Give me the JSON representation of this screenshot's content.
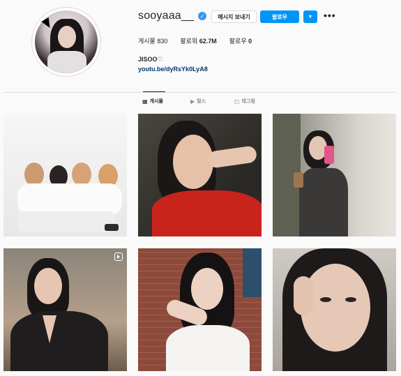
{
  "profile": {
    "username": "sooyaaa__",
    "verified_icon": "verified-badge-icon",
    "message_button": "메시지 보내기",
    "follow_button": "팔로우",
    "dropdown_icon": "chevron-down-icon",
    "more_icon": "more-options-icon",
    "more_glyph": "•••",
    "stats": {
      "posts_label": "게시물",
      "posts_value": "830",
      "followers_label": "팔로워",
      "followers_value": "62.7M",
      "following_label": "팔로우",
      "following_value": "0"
    },
    "bio_name": "JISOO♡",
    "bio_link": "youtu.be/dyRsYk0LyA8"
  },
  "tabs": [
    {
      "label": "게시물",
      "icon": "grid-icon",
      "glyph": "▦",
      "active": true
    },
    {
      "label": "릴스",
      "icon": "reels-icon",
      "glyph": "▶",
      "active": false
    },
    {
      "label": "태그됨",
      "icon": "tagged-icon",
      "glyph": "◰",
      "active": false
    }
  ],
  "posts": [
    {
      "id": "post-1",
      "type": "image",
      "colors": [
        "#f2f2f2",
        "#e6e2e0"
      ]
    },
    {
      "id": "post-2",
      "type": "image",
      "colors": [
        "#3c3b36",
        "#c9221d"
      ]
    },
    {
      "id": "post-3",
      "type": "image",
      "colors": [
        "#8a8a7d",
        "#2a2826"
      ]
    },
    {
      "id": "post-4",
      "type": "reel",
      "colors": [
        "#6f6a62",
        "#1e1b1d"
      ]
    },
    {
      "id": "post-5",
      "type": "image",
      "colors": [
        "#8f4a3a",
        "#f4f1ee"
      ]
    },
    {
      "id": "post-6",
      "type": "image",
      "colors": [
        "#b8b3ad",
        "#1e1a1a"
      ]
    }
  ],
  "colors": {
    "accent": "#0095f6",
    "link": "#00376b",
    "border": "#dbdbdb"
  }
}
